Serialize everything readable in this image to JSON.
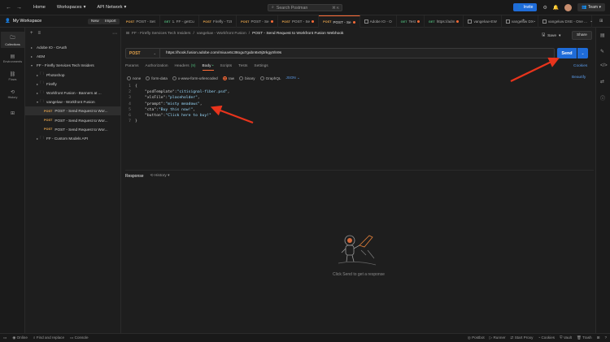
{
  "topbar": {
    "nav": [
      "Home",
      "Workspaces",
      "API Network"
    ],
    "search_placeholder": "Search Postman",
    "search_kbd": "⌘ K",
    "invite": "Invite",
    "team": "Team"
  },
  "workspace": {
    "title": "My Workspace",
    "new_label": "New",
    "import_label": "Import"
  },
  "tabs": [
    {
      "method": "POST",
      "label": "POST - Set",
      "dot": false,
      "kind": "req"
    },
    {
      "method": "GET",
      "label": "1. FF - getCu",
      "dot": false,
      "kind": "req"
    },
    {
      "method": "POST",
      "label": "Firefly - T2I",
      "dot": false,
      "kind": "req"
    },
    {
      "method": "POST",
      "label": "POST - Se",
      "dot": true,
      "kind": "req"
    },
    {
      "method": "POST",
      "label": "POST - Se",
      "dot": true,
      "kind": "req"
    },
    {
      "method": "POST",
      "label": "POST - Se",
      "dot": true,
      "kind": "req",
      "active": true
    },
    {
      "method": "",
      "label": "Adobe IO - O",
      "dot": false,
      "kind": "coll"
    },
    {
      "method": "GET",
      "label": "Test",
      "dot": true,
      "kind": "req"
    },
    {
      "method": "GET",
      "label": "https://adm",
      "dot": true,
      "kind": "req"
    },
    {
      "method": "",
      "label": "vangeluw-EW",
      "dot": false,
      "kind": "coll"
    },
    {
      "method": "",
      "label": "vangeluw DX",
      "dot": false,
      "kind": "coll"
    },
    {
      "method": "",
      "label": "vangeluw DXE - One ...",
      "dot": false,
      "kind": "env"
    }
  ],
  "rail": [
    {
      "label": "Collections",
      "icon": "collections-icon"
    },
    {
      "label": "Environments",
      "icon": "environments-icon"
    },
    {
      "label": "Flows",
      "icon": "flows-icon"
    },
    {
      "label": "History",
      "icon": "history-icon"
    }
  ],
  "tree": [
    {
      "label": "Adobe IO - OAuth",
      "level": 0,
      "type": "collection",
      "open": false
    },
    {
      "label": "AEM",
      "level": 0,
      "type": "collection",
      "open": false
    },
    {
      "label": "FF - Firefly Services Tech Insiders",
      "level": 0,
      "type": "collection",
      "open": true
    },
    {
      "label": "Photoshop",
      "level": 1,
      "type": "folder",
      "open": false
    },
    {
      "label": "Firefly",
      "level": 1,
      "type": "folder",
      "open": false
    },
    {
      "label": "Workfront Fusion - Banners at ...",
      "level": 1,
      "type": "folder",
      "open": false
    },
    {
      "label": "vangeluw - Workfront Fusion",
      "level": 1,
      "type": "folder",
      "open": true
    },
    {
      "label": "POST - Send Request to Wor...",
      "level": 2,
      "type": "request",
      "method": "POST",
      "selected": true
    },
    {
      "label": "POST - Send Request to Wor...",
      "level": 2,
      "type": "request",
      "method": "POST"
    },
    {
      "label": "POST - Send Request to Wor...",
      "level": 2,
      "type": "request",
      "method": "POST"
    },
    {
      "label": "FF - Custom Models API",
      "level": 1,
      "type": "folder",
      "open": false
    }
  ],
  "breadcrumb": {
    "parts": [
      "FF - Firefly Services Tech Insiders",
      "vangeluw - Workfront Fusion"
    ],
    "current": "POST - Send Request to Workfront Fusion Webhook"
  },
  "actions": {
    "save": "Save",
    "share": "Share"
  },
  "request": {
    "method": "POST",
    "url": "https://hook.fusion.adobe.com/miuuv6c38ogu7gubn6x9j3rkgytrln9s",
    "send": "Send",
    "tabs": [
      {
        "label": "Params"
      },
      {
        "label": "Authorization"
      },
      {
        "label": "Headers",
        "count": "(9)"
      },
      {
        "label": "Body",
        "active": true
      },
      {
        "label": "Scripts"
      },
      {
        "label": "Tests"
      },
      {
        "label": "Settings"
      }
    ],
    "cookies": "Cookies",
    "body_modes": [
      "none",
      "form-data",
      "x-www-form-urlencoded",
      "raw",
      "binary",
      "GraphQL"
    ],
    "body_mode_selected": "raw",
    "body_format": "JSON",
    "beautify": "Beautify",
    "code": [
      {
        "n": "1",
        "text": "{"
      },
      {
        "n": "2",
        "key": "\"psdTemplate\"",
        "val": "\"citisignal-fiber.psd\""
      },
      {
        "n": "3",
        "key": "\"xlsFile\"",
        "val": "\"placeholder\""
      },
      {
        "n": "4",
        "key": "\"prompt\"",
        "val": "\"misty meadows\""
      },
      {
        "n": "5",
        "key": "\"cta\"",
        "val": "\"Buy this now!\""
      },
      {
        "n": "6",
        "key": "\"button\"",
        "val": "\"Click here to buy!\"",
        "last": true
      },
      {
        "n": "7",
        "text": "}"
      }
    ]
  },
  "response": {
    "title": "Response",
    "history": "History",
    "empty_message": "Click Send to get a response"
  },
  "status": {
    "left": [
      "Online",
      "Find and replace",
      "Console"
    ],
    "right": [
      "Postbot",
      "Runner",
      "Start Proxy",
      "Cookies",
      "Vault",
      "Trash"
    ]
  },
  "colors": {
    "accent": "#ff6c37",
    "send": "#1f6cd8",
    "annotation_arrow": "#e8341c"
  }
}
